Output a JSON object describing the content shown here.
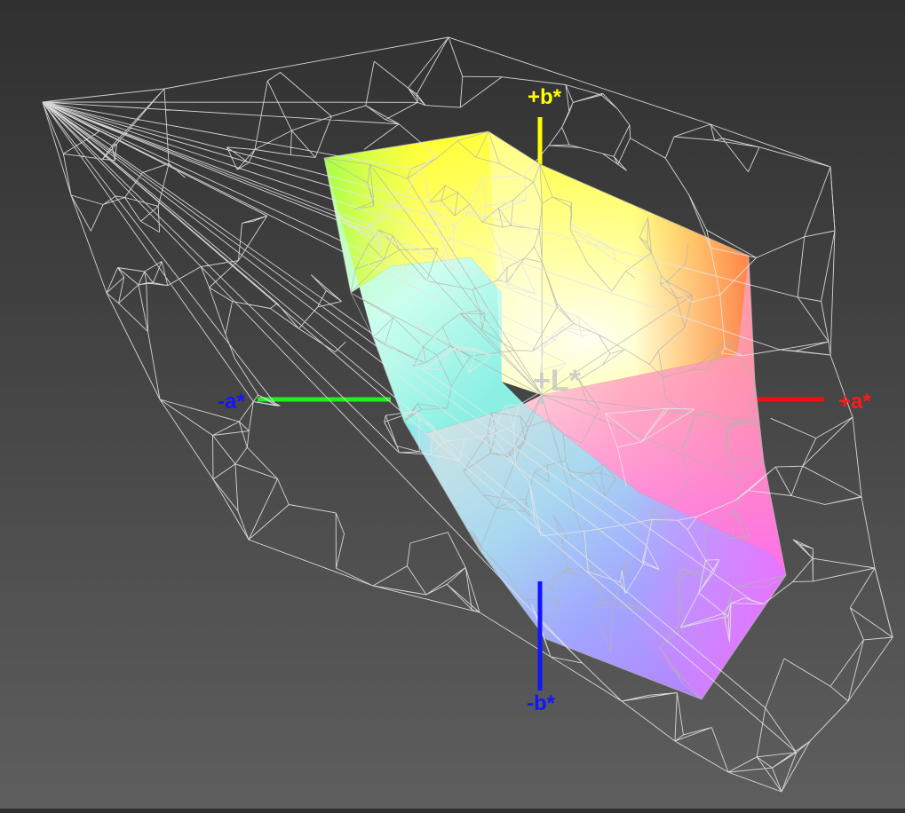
{
  "axes": {
    "plus_b": {
      "label": "+b*",
      "color": "#ffff00"
    },
    "minus_b": {
      "label": "-b*",
      "color": "#1414ff"
    },
    "plus_a": {
      "label": "+a*",
      "color": "#ff1a1a"
    },
    "minus_a": {
      "label": "-a*",
      "color": "#1414ff"
    },
    "plus_L": {
      "label": "+L*",
      "color": "#c8c8c8"
    }
  },
  "colors": {
    "background_top": "#303030",
    "background_bottom": "#5e5e5e",
    "wireframe": "#e6e6e6",
    "axis_green": "#22ee22",
    "axis_red": "#ee1111",
    "axis_blue": "#1414ff",
    "axis_yellow": "#ffff00"
  }
}
